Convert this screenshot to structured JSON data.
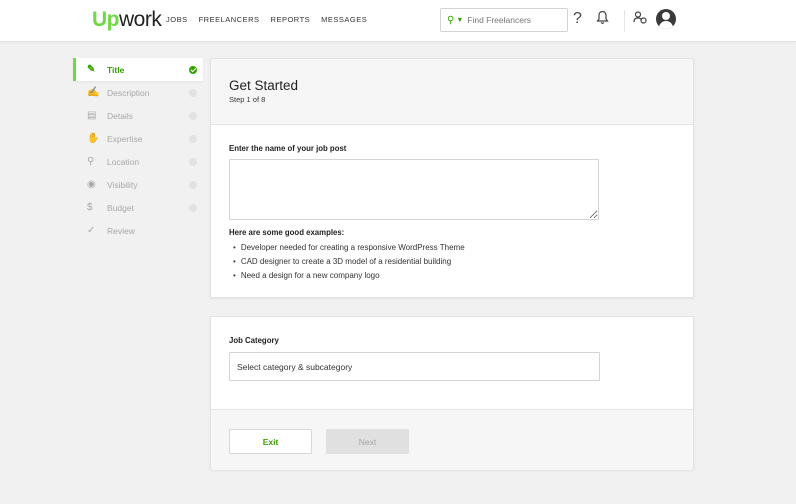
{
  "header": {
    "logo_up": "Up",
    "logo_rest": "work",
    "nav": [
      "JOBS",
      "FREELANCERS",
      "REPORTS",
      "MESSAGES"
    ],
    "search_placeholder": "Find Freelancers",
    "icons": [
      "help-icon",
      "notification-bell-icon",
      "team-icon",
      "user-avatar"
    ]
  },
  "sidebar": {
    "steps": [
      {
        "label": "Title",
        "icon": "pencil-icon",
        "active": true
      },
      {
        "label": "Description",
        "icon": "edit-icon"
      },
      {
        "label": "Details",
        "icon": "list-icon"
      },
      {
        "label": "Expertise",
        "icon": "hand-icon"
      },
      {
        "label": "Location",
        "icon": "pin-icon"
      },
      {
        "label": "Visibility",
        "icon": "eye-icon"
      },
      {
        "label": "Budget",
        "icon": "dollar-icon"
      },
      {
        "label": "Review",
        "icon": "check-icon"
      }
    ]
  },
  "main": {
    "title": "Get Started",
    "step_info": "Step 1 of 8",
    "job_name_label": "Enter the name of your job post",
    "job_name_value": "",
    "examples_label": "Here are some good examples:",
    "examples": [
      "Developer needed for creating a responsive WordPress Theme",
      "CAD designer to create a 3D model of a residential building",
      "Need a design for a new company logo"
    ],
    "category_label": "Job Category",
    "category_placeholder": "Select category & subcategory",
    "exit_label": "Exit",
    "next_label": "Next"
  },
  "colors": {
    "brand": "#6fda44",
    "brand_dark": "#37a000"
  }
}
